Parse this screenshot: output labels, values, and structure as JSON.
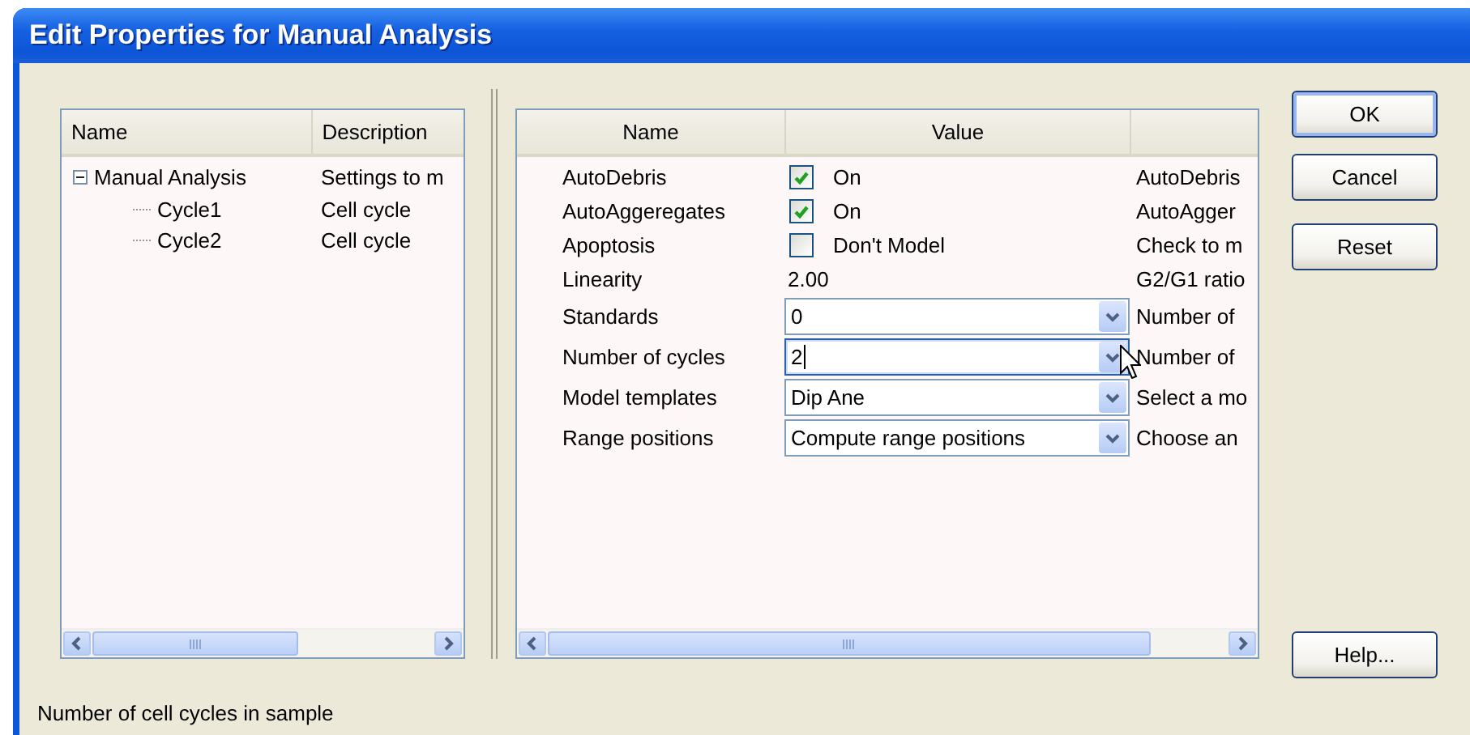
{
  "window": {
    "title": "Edit Properties for Manual Analysis"
  },
  "tree": {
    "columns": [
      "Name",
      "Description"
    ],
    "items": [
      {
        "name": "Manual Analysis",
        "description": "Settings to m",
        "expanded": true,
        "children": [
          {
            "name": "Cycle1",
            "description": "Cell cycle"
          },
          {
            "name": "Cycle2",
            "description": "Cell cycle"
          }
        ]
      }
    ]
  },
  "properties": {
    "columns": [
      "Name",
      "Value"
    ],
    "rows": [
      {
        "name": "AutoDebris",
        "kind": "checkbox",
        "checked": true,
        "value": "On",
        "description": "AutoDebris"
      },
      {
        "name": "AutoAggeregates",
        "kind": "checkbox",
        "checked": true,
        "value": "On",
        "description": "AutoAgger"
      },
      {
        "name": "Apoptosis",
        "kind": "checkbox",
        "checked": false,
        "value": "Don't Model",
        "description": "Check to m"
      },
      {
        "name": "Linearity",
        "kind": "text",
        "value": "2.00",
        "description": "G2/G1 ratio"
      },
      {
        "name": "Standards",
        "kind": "combo",
        "focused": false,
        "value": "0",
        "description": "Number of"
      },
      {
        "name": "Number of cycles",
        "kind": "combo",
        "focused": true,
        "value": "2",
        "description": "Number of"
      },
      {
        "name": "Model templates",
        "kind": "combo",
        "focused": false,
        "value": "Dip Ane",
        "description": "Select a mo"
      },
      {
        "name": "Range positions",
        "kind": "combo",
        "focused": false,
        "value": "Compute range positions",
        "description": "Choose an"
      }
    ]
  },
  "buttons": [
    {
      "label": "OK",
      "default": true
    },
    {
      "label": "Cancel",
      "default": false
    },
    {
      "label": "Reset",
      "default": false
    }
  ],
  "help_button": {
    "label": "Help..."
  },
  "status_bar": {
    "text": "Number of cell cycles in sample"
  }
}
